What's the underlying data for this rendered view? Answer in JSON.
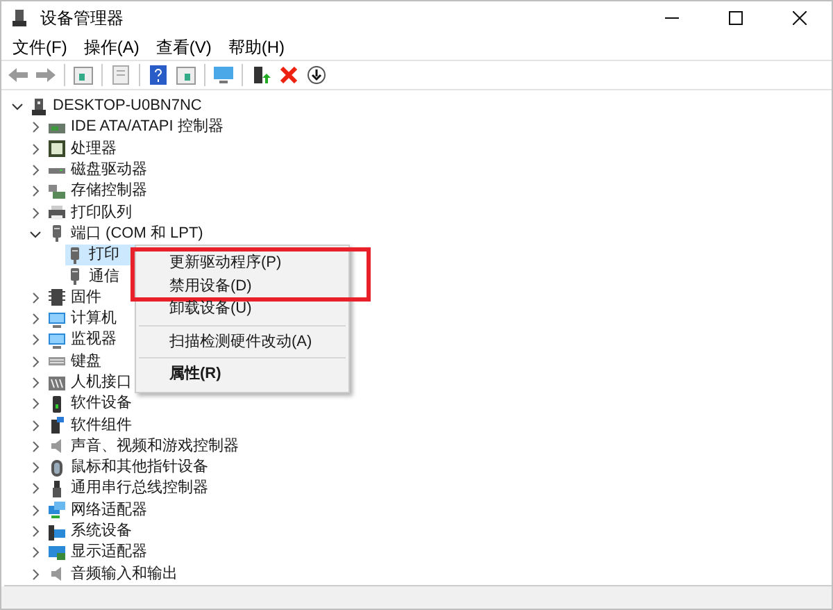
{
  "window": {
    "title": "设备管理器"
  },
  "menu_bar": [
    "文件(F)",
    "操作(A)",
    "查看(V)",
    "帮助(H)"
  ],
  "tree": {
    "label": "DESKTOP-U0BN7NC",
    "expanded": true,
    "selected": false,
    "children": [
      {
        "label": "IDE ATA/ATAPI 控制器",
        "expanded": false,
        "selected": false
      },
      {
        "label": "处理器",
        "expanded": false,
        "selected": false
      },
      {
        "label": "磁盘驱动器",
        "expanded": false,
        "selected": false
      },
      {
        "label": "存储控制器",
        "expanded": false,
        "selected": false
      },
      {
        "label": "打印队列",
        "expanded": false,
        "selected": false
      },
      {
        "label": "端口 (COM 和 LPT)",
        "expanded": true,
        "selected": false,
        "children": [
          {
            "label": "打印",
            "selected": true
          },
          {
            "label": "通信",
            "selected": false
          }
        ]
      },
      {
        "label": "固件",
        "expanded": false,
        "selected": false
      },
      {
        "label": "计算机",
        "expanded": false,
        "selected": false
      },
      {
        "label": "监视器",
        "expanded": false,
        "selected": false
      },
      {
        "label": "键盘",
        "expanded": false,
        "selected": false
      },
      {
        "label": "人机接口",
        "expanded": false,
        "selected": false
      },
      {
        "label": "软件设备",
        "expanded": false,
        "selected": false
      },
      {
        "label": "软件组件",
        "expanded": false,
        "selected": false
      },
      {
        "label": "声音、视频和游戏控制器",
        "expanded": false,
        "selected": false
      },
      {
        "label": "鼠标和其他指针设备",
        "expanded": false,
        "selected": false
      },
      {
        "label": "通用串行总线控制器",
        "expanded": false,
        "selected": false
      },
      {
        "label": "网络适配器",
        "expanded": false,
        "selected": false
      },
      {
        "label": "系统设备",
        "expanded": false,
        "selected": false
      },
      {
        "label": "显示适配器",
        "expanded": false,
        "selected": false
      },
      {
        "label": "音频输入和输出",
        "expanded": false,
        "selected": false
      }
    ]
  },
  "context_menu": {
    "items": [
      {
        "kind": "item",
        "label": "更新驱动程序(P)",
        "annotated": true
      },
      {
        "kind": "item",
        "label": "禁用设备(D)",
        "annotated": true
      },
      {
        "kind": "item",
        "label": "卸载设备(U)",
        "annotated": false
      },
      {
        "kind": "separator"
      },
      {
        "kind": "item",
        "label": "扫描检测硬件改动(A)",
        "annotated": false
      },
      {
        "kind": "separator"
      },
      {
        "kind": "default",
        "label": "属性(R)",
        "annotated": false
      }
    ]
  }
}
